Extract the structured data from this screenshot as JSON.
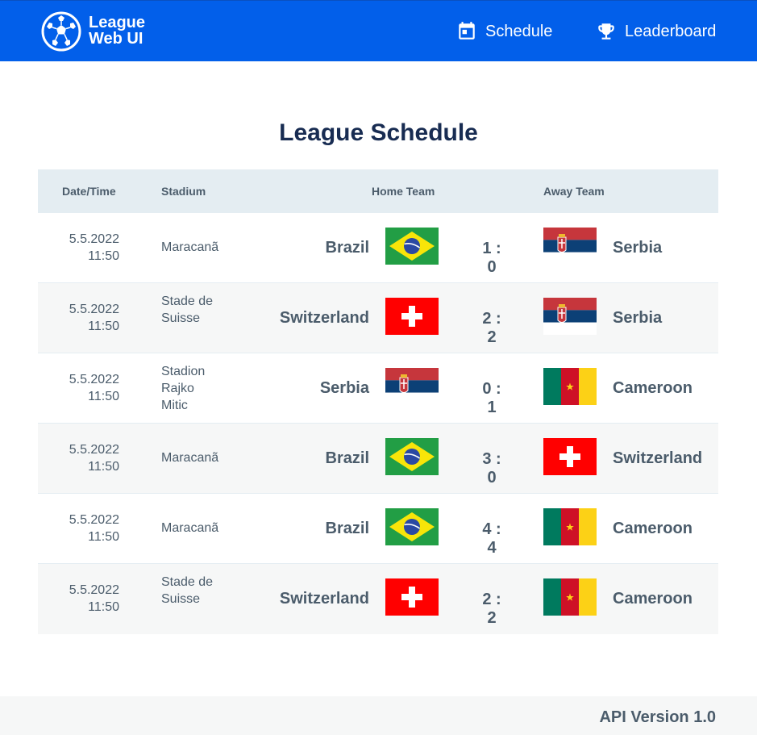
{
  "app": {
    "logo_line1": "League",
    "logo_line2": "Web UI"
  },
  "nav": {
    "schedule_label": "Schedule",
    "leaderboard_label": "Leaderboard"
  },
  "page_title": "League Schedule",
  "table": {
    "headers": {
      "datetime": "Date/Time",
      "stadium": "Stadium",
      "home": "Home Team",
      "away": "Away Team"
    },
    "rows": [
      {
        "date": "5.5.2022",
        "time": "11:50",
        "stadium": "Maracanã",
        "home": "Brazil",
        "home_flag": "brazil",
        "score": "1 : 0",
        "away": "Serbia",
        "away_flag": "serbia"
      },
      {
        "date": "5.5.2022",
        "time": "11:50",
        "stadium": "Stade de Suisse",
        "home": "Switzerland",
        "home_flag": "switzerland",
        "score": "2 : 2",
        "away": "Serbia",
        "away_flag": "serbia"
      },
      {
        "date": "5.5.2022",
        "time": "11:50",
        "stadium": "Stadion Rajko Mitic",
        "home": "Serbia",
        "home_flag": "serbia",
        "score": "0 : 1",
        "away": "Cameroon",
        "away_flag": "cameroon"
      },
      {
        "date": "5.5.2022",
        "time": "11:50",
        "stadium": "Maracanã",
        "home": "Brazil",
        "home_flag": "brazil",
        "score": "3 : 0",
        "away": "Switzerland",
        "away_flag": "switzerland"
      },
      {
        "date": "5.5.2022",
        "time": "11:50",
        "stadium": "Maracanã",
        "home": "Brazil",
        "home_flag": "brazil",
        "score": "4 : 4",
        "away": "Cameroon",
        "away_flag": "cameroon"
      },
      {
        "date": "5.5.2022",
        "time": "11:50",
        "stadium": "Stade de Suisse",
        "home": "Switzerland",
        "home_flag": "switzerland",
        "score": "2 : 2",
        "away": "Cameroon",
        "away_flag": "cameroon"
      }
    ]
  },
  "footer": {
    "api_version": "API Version 1.0"
  },
  "colors": {
    "header_bg": "#025fea",
    "title": "#182c52",
    "text": "#4b5c6b",
    "table_header_bg": "#e4edf2",
    "alt_row_bg": "#f6f7f7"
  },
  "icons": {
    "logo": "soccer-ball-icon",
    "schedule": "calendar-icon",
    "leaderboard": "trophy-icon"
  }
}
